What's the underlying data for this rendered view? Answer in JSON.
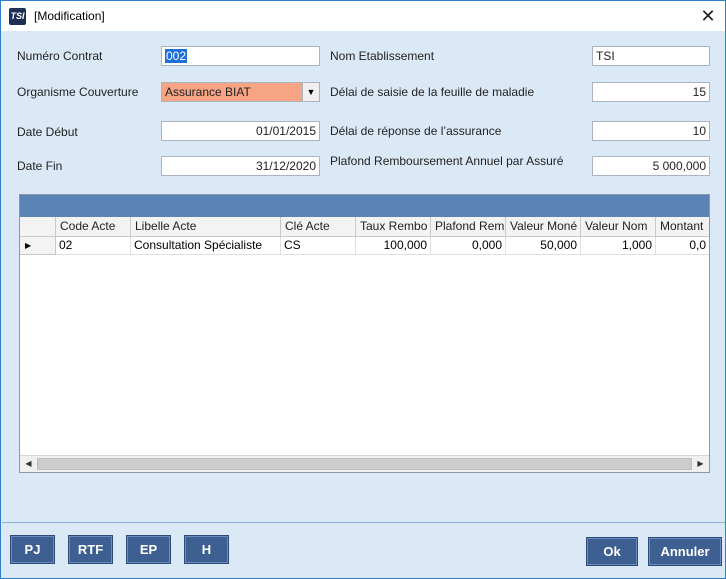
{
  "window": {
    "title": "[Modification]",
    "app_icon_text": "TSI",
    "close_glyph": "✕"
  },
  "form": {
    "numero_contrat_label": "Numéro Contrat",
    "numero_contrat_value": "002",
    "organisme_label": "Organisme Couverture",
    "organisme_value": "Assurance BIAT",
    "date_debut_label": "Date Début",
    "date_debut_value": "01/01/2015",
    "date_fin_label": "Date Fin",
    "date_fin_value": "31/12/2020",
    "nom_etab_label": "Nom Etablissement",
    "nom_etab_value": "TSI",
    "delai_saisie_label": "Délai de saisie de la feuille de maladie",
    "delai_saisie_value": "15",
    "delai_reponse_label": "Délai de réponse de l’assurance",
    "delai_reponse_value": "10",
    "plafond_label": "Plafond Remboursement Annuel par Assuré",
    "plafond_value": "5 000,000"
  },
  "table": {
    "columns": [
      "Code Acte",
      "Libelle Acte",
      "Clé Acte",
      "Taux Rembo",
      "Plafond Rem",
      "Valeur Moné",
      "Valeur Nom",
      "Montant"
    ],
    "rows": [
      [
        "02",
        "Consultation Spécialiste",
        "CS",
        "100,000",
        "0,000",
        "50,000",
        "1,000",
        "0,0"
      ]
    ],
    "row_indicator": "▶",
    "scroll_left": "◀",
    "scroll_right": "▶"
  },
  "buttons": {
    "pj": "PJ",
    "rtf": "RTF",
    "ep": "EP",
    "h": "H",
    "ok": "Ok",
    "annuler": "Annuler"
  },
  "colors": {
    "window_bg": "#dbe9f6",
    "button_bg": "#3e5f92",
    "combo_bg": "#f7a485",
    "grid_band": "#5b83b5",
    "selection": "#1e6fd6"
  },
  "icons": {
    "app": "tsi-logo-icon",
    "close": "close-icon",
    "dropdown": "chevron-down-icon"
  }
}
